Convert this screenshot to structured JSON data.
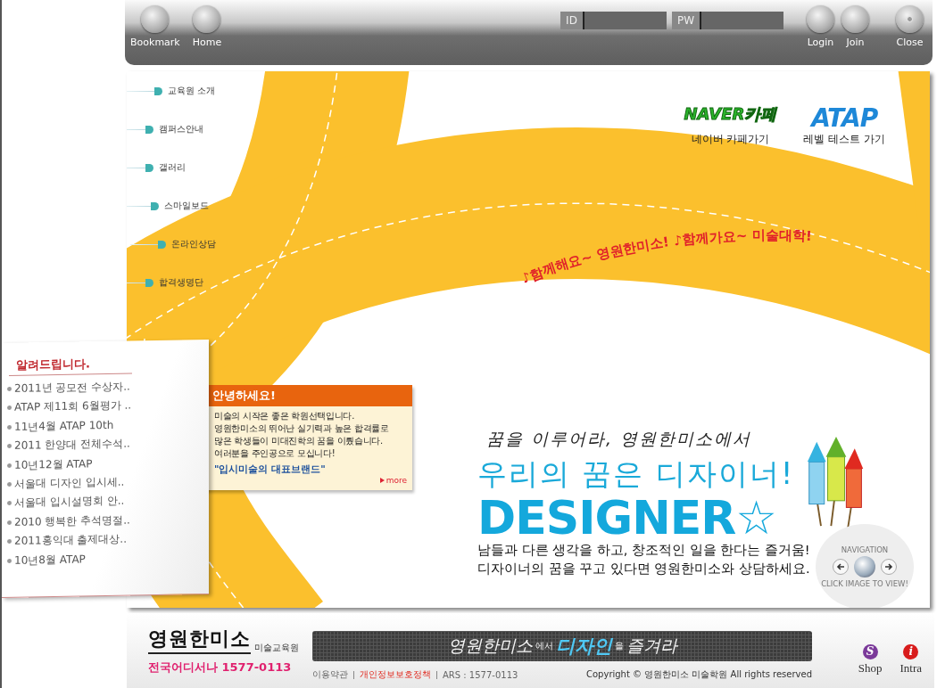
{
  "top_bar": {
    "left_buttons": [
      {
        "label": "Bookmark"
      },
      {
        "label": "Home"
      }
    ],
    "login": {
      "id_label": "ID",
      "pw_label": "PW"
    },
    "right_buttons": [
      {
        "label": "Login",
        "kind": "plain"
      },
      {
        "label": "Join",
        "kind": "plain"
      },
      {
        "label": "Close",
        "kind": "dot"
      }
    ]
  },
  "nav_menu": [
    {
      "label": "교육원 소개"
    },
    {
      "label": "캠퍼스안내"
    },
    {
      "label": "갤러리"
    },
    {
      "label": "스마일보드"
    },
    {
      "label": "온라인상담"
    },
    {
      "label": "합격생명단"
    }
  ],
  "quick_links": [
    {
      "logo": "NAVER카페",
      "label": "네이버 카페가기",
      "kind": "naver"
    },
    {
      "logo": "ATAP",
      "label": "레벨 테스트 가기",
      "kind": "atap"
    }
  ],
  "slogan": "♪함께해요~ 영원한미소!  ♪함께가요~ 미술대학!",
  "notice": {
    "title": "알려드립니다.",
    "items": [
      "2011년 공모전 수상자..",
      "ATAP 제11회 6월평가 ..",
      "11년4월 ATAP 10th",
      "2011 한양대 전체수석..",
      "10년12월 ATAP",
      "서울대 디자인 입시세..",
      "서울대 입시설명회 안..",
      "2010 행복한 추석명절..",
      "2011홍익대 출제대상..",
      "10년8월 ATAP"
    ]
  },
  "greeting": {
    "title": "안녕하세요!",
    "lines": [
      "미술의 시작은 좋은 학원선택입니다.",
      "영원한미소의 뛰어난 실기력과 높은 합격률로",
      "많은 학생들이 미대진학의 꿈을 이뤘습니다.",
      "여러분을 주인공으로 모십니다!"
    ],
    "tagline": "\"입시미술의 대표브랜드\"",
    "more": "more"
  },
  "hero": {
    "subtitle": "꿈을 이루어라, 영원한미소에서",
    "headline": "우리의 꿈은 디자이너!",
    "big_word": "DESIGNER☆",
    "lines": [
      "남들과 다른 생각을 하고, 창조적인 일을 한다는 즐거움!",
      "디자이너의 꿈을 꾸고 있다면 영원한미소와 상담하세요."
    ]
  },
  "navigation_widget": {
    "label": "NAVIGATION",
    "caption": "CLICK IMAGE TO VIEW!"
  },
  "footer": {
    "logo": "영원한미소",
    "logo_sub": "미술교육원",
    "phone": "전국어디서나 1577-0113",
    "banner": [
      {
        "text": "영원한미소",
        "kind": "plain"
      },
      {
        "text": "에서",
        "kind": "small"
      },
      {
        "text": "디자인",
        "kind": "highlight"
      },
      {
        "text": "을",
        "kind": "small"
      },
      {
        "text": "즐겨라",
        "kind": "plain"
      }
    ],
    "links": [
      {
        "label": "이용약관",
        "highlighted": false
      },
      {
        "label": "개인정보보호정책",
        "highlighted": true
      },
      {
        "label": "ARS : 1577-0113",
        "highlighted": false
      }
    ],
    "copyright": "Copyright ©  영원한미소 미술학원  All rights reserved",
    "side_buttons": [
      {
        "letter": "S",
        "label": "Shop",
        "color": "#7b3a9a"
      },
      {
        "letter": "i",
        "label": "Intra",
        "color": "#d81c1c"
      }
    ]
  }
}
